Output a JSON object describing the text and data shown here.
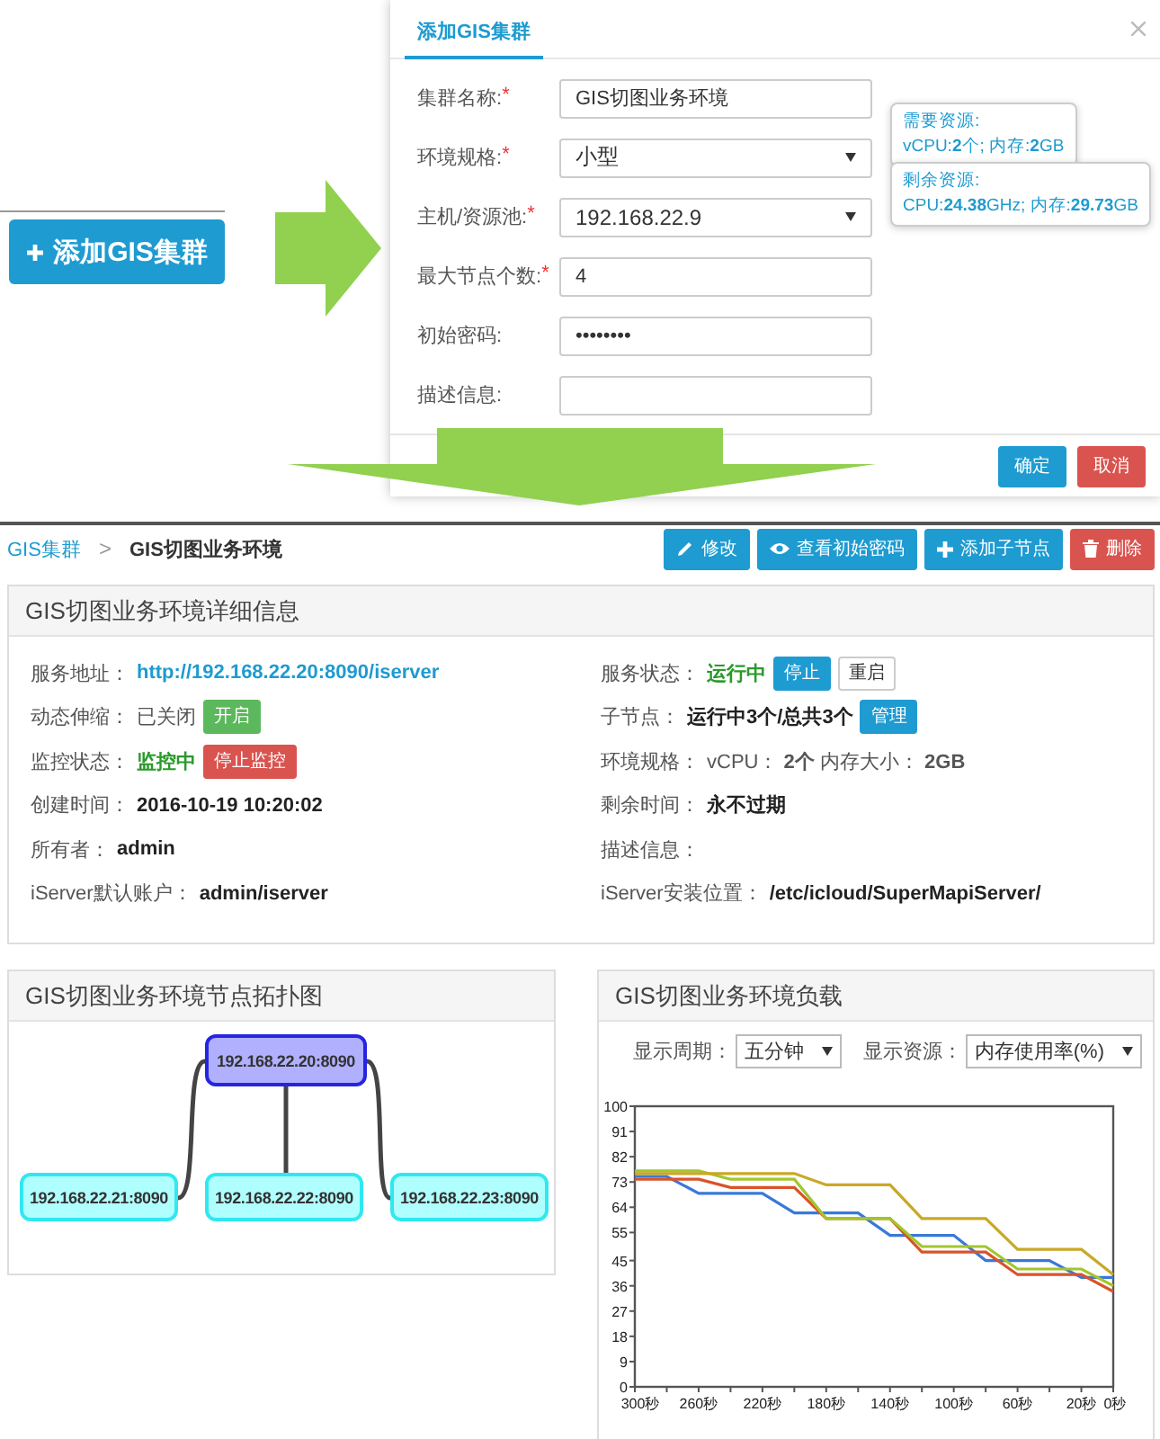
{
  "left": {
    "add_button": "添加GIS集群"
  },
  "dialog": {
    "title": "添加GIS集群",
    "fields": [
      {
        "label": "集群名称:",
        "required_mark": "*",
        "kind": "text",
        "value": "GIS切图业务环境"
      },
      {
        "label": "环境规格:",
        "required_mark": "*",
        "kind": "select",
        "value": "小型",
        "tooltip": {
          "title": "需要资源:",
          "detail": "vCPU:**2**个; 内存:**2**GB"
        }
      },
      {
        "label": "主机/资源池:",
        "required_mark": "*",
        "kind": "select",
        "value": "192.168.22.9",
        "tooltip": {
          "title": "剩余资源:",
          "detail": "CPU:**24.38**GHz; 内存:**29.73**GB"
        }
      },
      {
        "label": "最大节点个数:",
        "required_mark": "*",
        "kind": "text",
        "value": "4"
      },
      {
        "label": "初始密码:",
        "kind": "text",
        "value": "••••••••"
      },
      {
        "label": "描述信息:",
        "kind": "text"
      }
    ],
    "buttons": [
      {
        "label": "确定",
        "kind": "primary"
      },
      {
        "label": "取消",
        "kind": "danger"
      }
    ]
  },
  "breadcrumb": {
    "parent": "GIS集群",
    "separator": ">",
    "current": "GIS切图业务环境"
  },
  "actions": [
    {
      "label": "修改",
      "kind": "edit"
    },
    {
      "label": "查看初始密码",
      "kind": "view"
    },
    {
      "label": "添加子节点",
      "kind": "add"
    },
    {
      "label": "删除",
      "kind": "delete"
    }
  ],
  "details": {
    "title": "GIS切图业务环境详细信息",
    "left": [
      {
        "label": "服务地址：",
        "value": "http://192.168.22.20:8090/iserver",
        "kind": "link"
      },
      {
        "label": "动态伸缩：",
        "value": "已关闭",
        "kind": "text",
        "buttons": [
          {
            "label": "开启",
            "kind": "success"
          }
        ]
      },
      {
        "label": "监控状态：",
        "value": "监控中",
        "kind": "ok",
        "buttons": [
          {
            "label": "停止监控",
            "kind": "danger"
          }
        ]
      },
      {
        "label": "创建时间：",
        "value": "2016-10-19 10:20:02",
        "kind": "strong"
      },
      {
        "label": "所有者：",
        "value": "admin",
        "kind": "strong"
      },
      {
        "label": "iServer默认账户：",
        "value": "admin/iserver",
        "kind": "strong"
      }
    ],
    "right": [
      {
        "label": "服务状态：",
        "value": "运行中",
        "kind": "ok",
        "buttons": [
          {
            "label": "停止",
            "kind": "primary"
          },
          {
            "label": "重启",
            "kind": "default"
          }
        ]
      },
      {
        "label": "子节点：",
        "value": "运行中**3**个/总共**3**个",
        "kind": "strong",
        "buttons": [
          {
            "label": "管理",
            "kind": "primary"
          }
        ]
      },
      {
        "label": "环境规格：",
        "value": "vCPU： **2个**  内存大小： **2GB**",
        "kind": "text"
      },
      {
        "label": "剩余时间：",
        "value": "永不过期",
        "kind": "strong"
      },
      {
        "label": "描述信息："
      },
      {
        "label": "iServer安装位置：",
        "value": "/etc/icloud/SuperMapiServer/",
        "kind": "strong"
      }
    ]
  },
  "topology": {
    "title": "GIS切图业务环境节点拓扑图",
    "root": {
      "label": "192.168.22.20:8090",
      "children": [
        {
          "label": "192.168.22.21:8090"
        },
        {
          "label": "192.168.22.22:8090"
        },
        {
          "label": "192.168.22.23:8090"
        }
      ]
    }
  },
  "load": {
    "title": "GIS切图业务环境负载",
    "filters": [
      {
        "label": "显示周期：",
        "value": "五分钟"
      },
      {
        "label": "显示资源：",
        "value": "内存使用率(%)"
      }
    ],
    "chart_data": {
      "type": "line",
      "x": [
        300,
        280,
        260,
        240,
        220,
        200,
        180,
        160,
        140,
        120,
        100,
        80,
        60,
        40,
        20,
        0
      ],
      "xlim": [
        300,
        0
      ],
      "ylim": [
        0,
        100
      ],
      "xticks": [
        {
          "value": 300,
          "label": "300秒"
        },
        {
          "value": 260,
          "label": "260秒"
        },
        {
          "value": 220,
          "label": "220秒"
        },
        {
          "value": 180,
          "label": "180秒"
        },
        {
          "value": 140,
          "label": "140秒"
        },
        {
          "value": 100,
          "label": "100秒"
        },
        {
          "value": 60,
          "label": "60秒"
        },
        {
          "value": 20,
          "label": "20秒"
        },
        {
          "value": 0,
          "label": "0秒"
        }
      ],
      "yticks": [
        0,
        9,
        18,
        27,
        36,
        45,
        55,
        64,
        73,
        82,
        91,
        100
      ],
      "series": [
        {
          "color": "#3a78d8",
          "values": [
            75,
            75,
            69,
            69,
            69,
            62,
            62,
            62,
            54,
            54,
            54,
            45,
            45,
            45,
            39,
            39
          ]
        },
        {
          "color": "#d9532a",
          "values": [
            74,
            74,
            74,
            71,
            71,
            71,
            60,
            60,
            60,
            48,
            48,
            48,
            40,
            40,
            40,
            34
          ]
        },
        {
          "color": "#a2c62c",
          "values": [
            77,
            77,
            77,
            74,
            74,
            74,
            60,
            60,
            60,
            50,
            50,
            50,
            42,
            42,
            42,
            36
          ]
        },
        {
          "color": "#c9a826",
          "values": [
            76,
            76,
            76,
            76,
            76,
            76,
            72,
            72,
            72,
            60,
            60,
            60,
            49,
            49,
            49,
            40
          ]
        }
      ]
    }
  }
}
